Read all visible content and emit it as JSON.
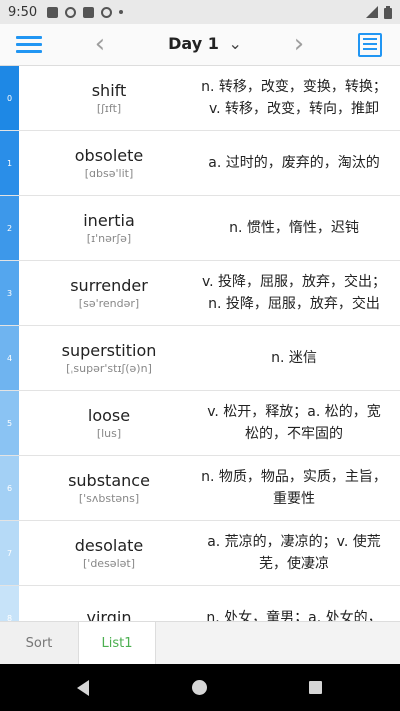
{
  "status_bar": {
    "time": "9:50"
  },
  "header": {
    "title": "Day 1",
    "prev_symbol": "‹",
    "next_symbol": "›",
    "dropdown_symbol": "⌄"
  },
  "words": [
    {
      "index": "0",
      "word": "shift",
      "phonetic": "[ʃɪft]",
      "definition": "n. 转移，改变，变换，转换；v. 转移，改变，转向，推卸",
      "bar_color": "#1e88e5"
    },
    {
      "index": "1",
      "word": "obsolete",
      "phonetic": "[ɑbsə'lit]",
      "definition": "a. 过时的，废弃的，淘汰的",
      "bar_color": "#2a8ee8"
    },
    {
      "index": "2",
      "word": "inertia",
      "phonetic": "[ɪ'nərʃə]",
      "definition": "n. 惯性，惰性，迟钝",
      "bar_color": "#3d98ea"
    },
    {
      "index": "3",
      "word": "surrender",
      "phonetic": "[sə'rendər]",
      "definition": "v. 投降，屈服，放弃，交出；n. 投降，屈服，放弃，交出",
      "bar_color": "#54a6ee"
    },
    {
      "index": "4",
      "word": "superstition",
      "phonetic": "[ˌsupər'stɪʃ(ə)n]",
      "definition": "n. 迷信",
      "bar_color": "#6fb4f0"
    },
    {
      "index": "5",
      "word": "loose",
      "phonetic": "[lus]",
      "definition": "v. 松开，释放；a. 松的，宽松的，不牢固的",
      "bar_color": "#8ac3f3"
    },
    {
      "index": "6",
      "word": "substance",
      "phonetic": "['sʌbstəns]",
      "definition": "n. 物质，物品，实质，主旨，重要性",
      "bar_color": "#a3d0f5"
    },
    {
      "index": "7",
      "word": "desolate",
      "phonetic": "['desələt]",
      "definition": "a. 荒凉的，凄凉的；v. 使荒芜，使凄凉",
      "bar_color": "#b6daf7"
    },
    {
      "index": "8",
      "word": "virgin",
      "phonetic": "",
      "definition": "n. 处女，童男；a. 处女的，",
      "bar_color": "#c7e3f9"
    }
  ],
  "tabs": {
    "sort": "Sort",
    "list1": "List1"
  },
  "colors": {
    "accent": "#2196f3",
    "active_tab": "#4caf50"
  }
}
